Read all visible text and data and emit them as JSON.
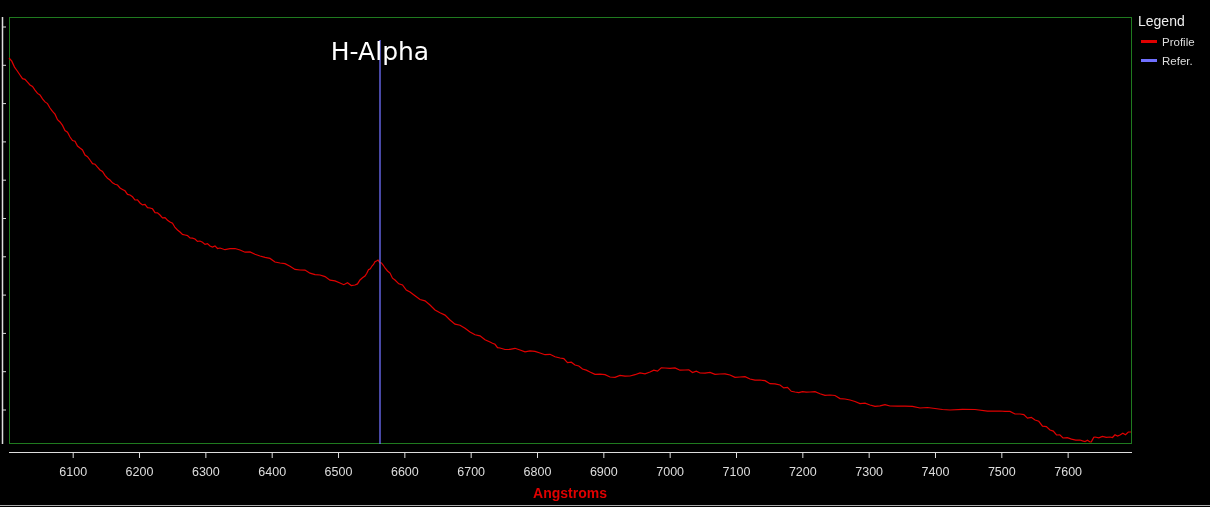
{
  "marker": {
    "label": "H-Alpha"
  },
  "legend": {
    "title": "Legend",
    "items": [
      {
        "label": "Profile",
        "color": "#e00000"
      },
      {
        "label": "Refer.",
        "color": "#7070ff"
      }
    ]
  },
  "x_axis": {
    "title": "Angstroms",
    "ticks": [
      "6100",
      "6200",
      "6300",
      "6400",
      "6500",
      "6600",
      "6700",
      "6800",
      "6900",
      "7000",
      "7100",
      "7200",
      "7300",
      "7400",
      "7500",
      "7600"
    ]
  }
}
